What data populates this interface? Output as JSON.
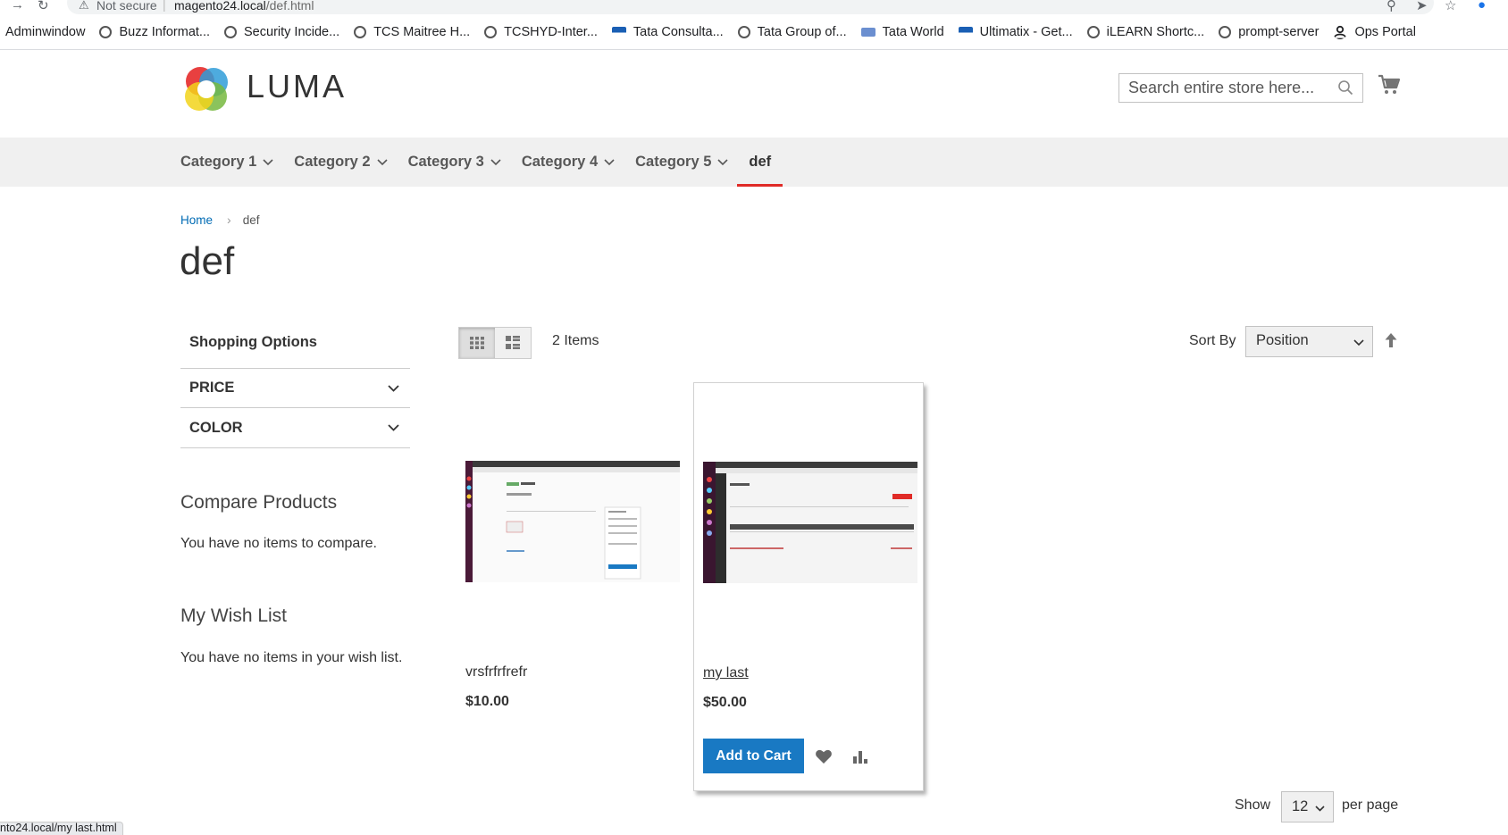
{
  "browser": {
    "security_label": "Not secure",
    "url_host": "magento24.local",
    "url_path": "/def.html",
    "status_url": "nto24.local/my last.html"
  },
  "bookmarks": [
    {
      "label": "Adminwindow",
      "icon": "none"
    },
    {
      "label": "Buzz Informat...",
      "icon": "globe-icon"
    },
    {
      "label": "Security Incide...",
      "icon": "globe-icon"
    },
    {
      "label": "TCS Maitree H...",
      "icon": "globe-icon"
    },
    {
      "label": "TCSHYD-Inter...",
      "icon": "globe-icon"
    },
    {
      "label": "Tata Consulta...",
      "icon": "tata-icon"
    },
    {
      "label": "Tata Group of...",
      "icon": "globe-icon"
    },
    {
      "label": "Tata World",
      "icon": "tata-world-icon"
    },
    {
      "label": "Ultimatix - Get...",
      "icon": "tata-icon"
    },
    {
      "label": "iLEARN Shortc...",
      "icon": "globe-icon"
    },
    {
      "label": "prompt-server",
      "icon": "globe-icon"
    },
    {
      "label": "Ops Portal",
      "icon": "person-icon"
    }
  ],
  "header": {
    "logo_text": "LUMA",
    "search_placeholder": "Search entire store here..."
  },
  "nav": {
    "items": [
      {
        "label": "Category 1"
      },
      {
        "label": "Category 2"
      },
      {
        "label": "Category 3"
      },
      {
        "label": "Category 4"
      },
      {
        "label": "Category 5"
      },
      {
        "label": "def"
      }
    ],
    "active_index": 5
  },
  "breadcrumbs": {
    "home": "Home",
    "current": "def"
  },
  "page_title": "def",
  "sidebar": {
    "shopping_options": "Shopping Options",
    "filters": [
      "PRICE",
      "COLOR"
    ],
    "compare_title": "Compare Products",
    "compare_empty": "You have no items to compare.",
    "wishlist_title": "My Wish List",
    "wishlist_empty": "You have no items in your wish list."
  },
  "toolbar": {
    "amount": "2 Items",
    "sort_label": "Sort By",
    "sort_value": "Position",
    "show_label": "Show",
    "limit_value": "12",
    "per_page": "per page"
  },
  "products": [
    {
      "name": "vrsfrfrfrefr",
      "price": "$10.00"
    },
    {
      "name": "my last",
      "price": "$50.00",
      "add_to_cart": "Add to Cart"
    }
  ],
  "colors": {
    "accent_blue": "#1979c3",
    "active_underline": "#e02b27",
    "nav_bg": "#f0f0f0",
    "link": "#006bb4"
  }
}
